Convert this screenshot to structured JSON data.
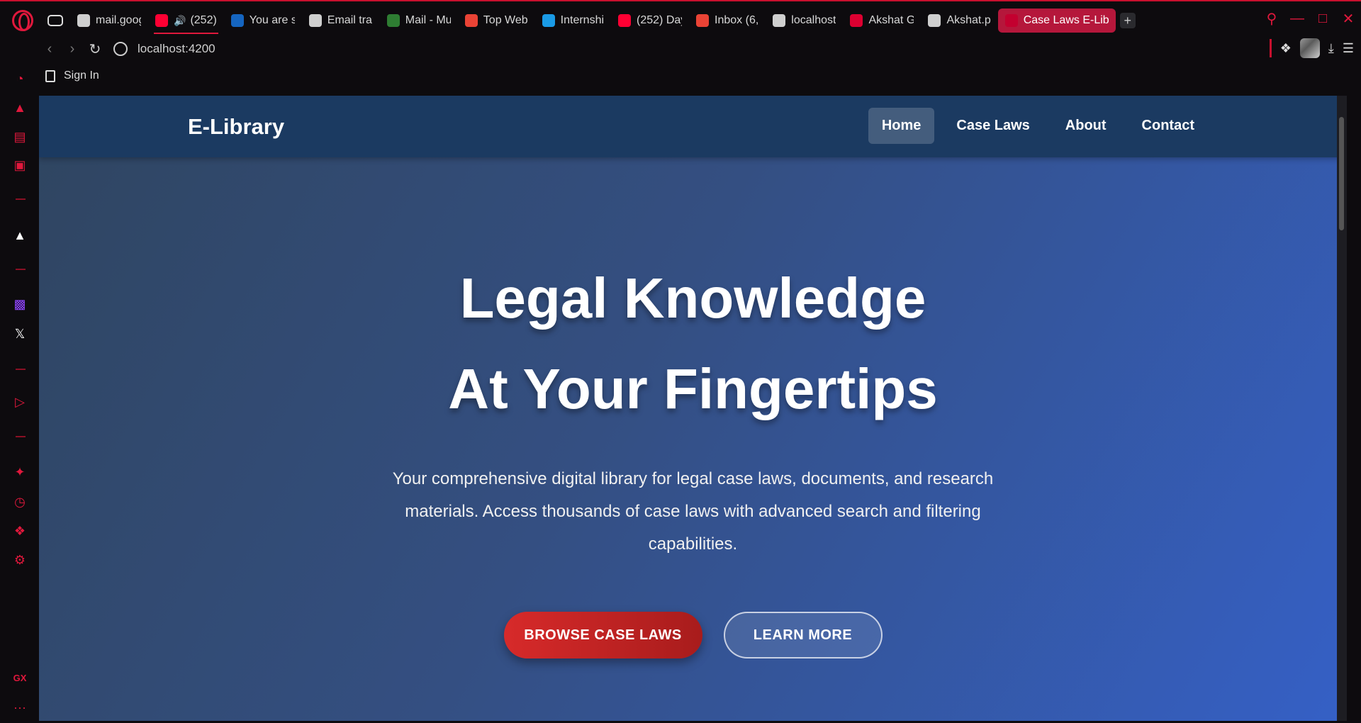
{
  "browser": {
    "tabs": [
      {
        "title": "mail.goog",
        "icon": "globe-icon",
        "color": "#cfcfcf"
      },
      {
        "title": "(252)",
        "icon": "youtube-icon",
        "color": "#ff0033",
        "audio": true
      },
      {
        "title": "You are s",
        "icon": "s-app-icon",
        "color": "#1565c0"
      },
      {
        "title": "Email trar",
        "icon": "openai-icon",
        "color": "#cfcfcf"
      },
      {
        "title": "Mail - Mu",
        "icon": "mail-icon",
        "color": "#2e7d32"
      },
      {
        "title": "Top Web",
        "icon": "gmail-icon",
        "color": "#ea4335"
      },
      {
        "title": "Internshi",
        "icon": "internshala-icon",
        "color": "#1a9be6"
      },
      {
        "title": "(252) Day",
        "icon": "youtube-icon",
        "color": "#ff0033"
      },
      {
        "title": "Inbox (6,",
        "icon": "gmail-icon",
        "color": "#ea4335"
      },
      {
        "title": "localhost",
        "icon": "globe-icon",
        "color": "#cfcfcf"
      },
      {
        "title": "Akshat G",
        "icon": "angular-icon",
        "color": "#dd0031"
      },
      {
        "title": "Akshat.p",
        "icon": "globe-icon",
        "color": "#cfcfcf"
      },
      {
        "title": "Case Laws E-Libr",
        "icon": "angular-icon",
        "color": "#c3002f",
        "active": true
      }
    ],
    "address": "localhost:4200",
    "bookmark": "Sign In",
    "accent": "#e0183c"
  },
  "site": {
    "brand": "E-Library",
    "nav": [
      "Home",
      "Case Laws",
      "About",
      "Contact"
    ],
    "hero_line1": "Legal Knowledge",
    "hero_line2": "At Your Fingertips",
    "description": "Your comprehensive digital library for legal case laws, documents, and research materials. Access thousands of case laws with advanced search and filtering capabilities.",
    "primary_cta": "BROWSE CASE LAWS",
    "secondary_cta": "LEARN MORE"
  },
  "sidebar": {
    "bottom_label": "GX",
    "more": "···"
  }
}
